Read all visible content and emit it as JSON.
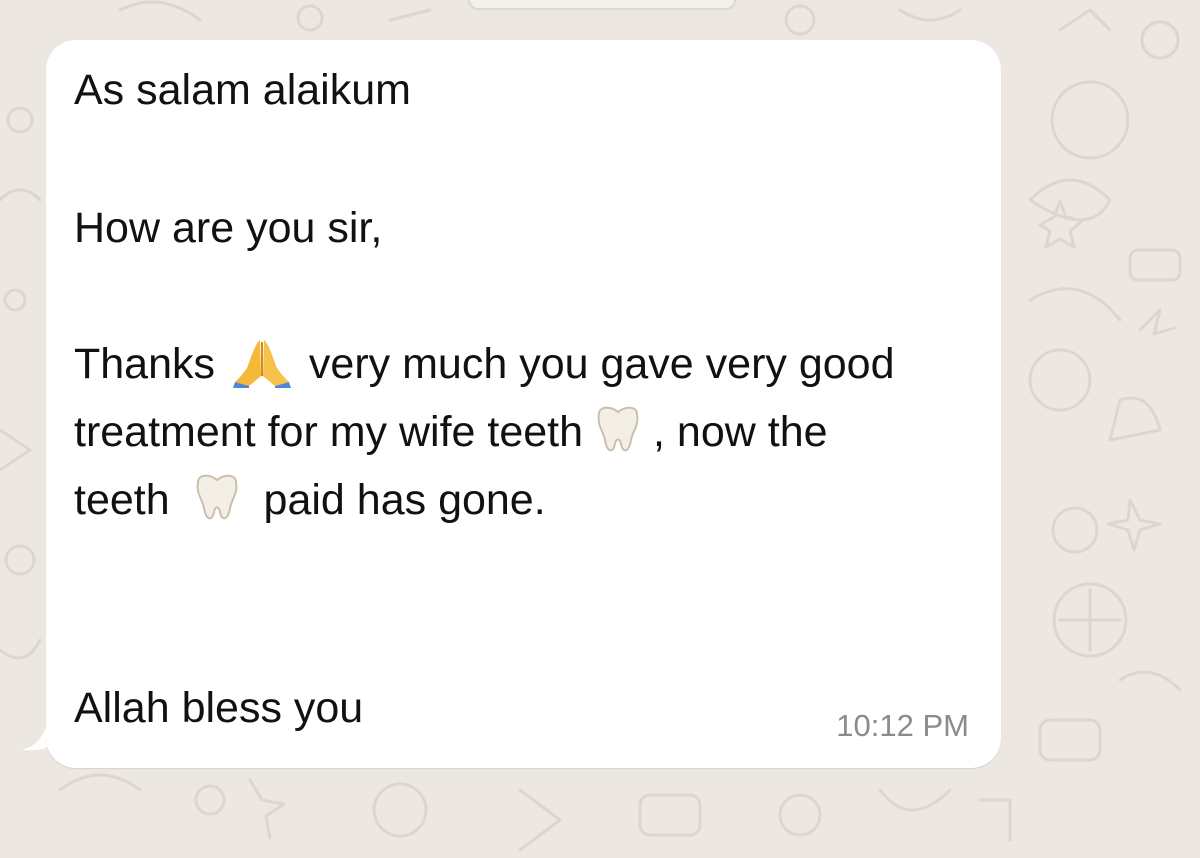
{
  "message": {
    "greeting": "As salam alaikum",
    "question": "How are you sir,",
    "body_line1_start": "Thanks",
    "body_line1_end": "very much you gave very good",
    "body_line2_start": "treatment for my wife teeth",
    "body_line2_end": ", now the",
    "body_line3_start": "teeth",
    "body_line3_end": "paid has gone.",
    "closing": "Allah bless you",
    "time": "10:12 PM"
  },
  "icons": {
    "pray": "folded-hands-emoji",
    "tooth": "tooth-emoji"
  },
  "colors": {
    "wallpaper": "#ece8e1",
    "bubble": "#ffffff",
    "text": "#111111",
    "timestamp": "#8b8b8b"
  }
}
